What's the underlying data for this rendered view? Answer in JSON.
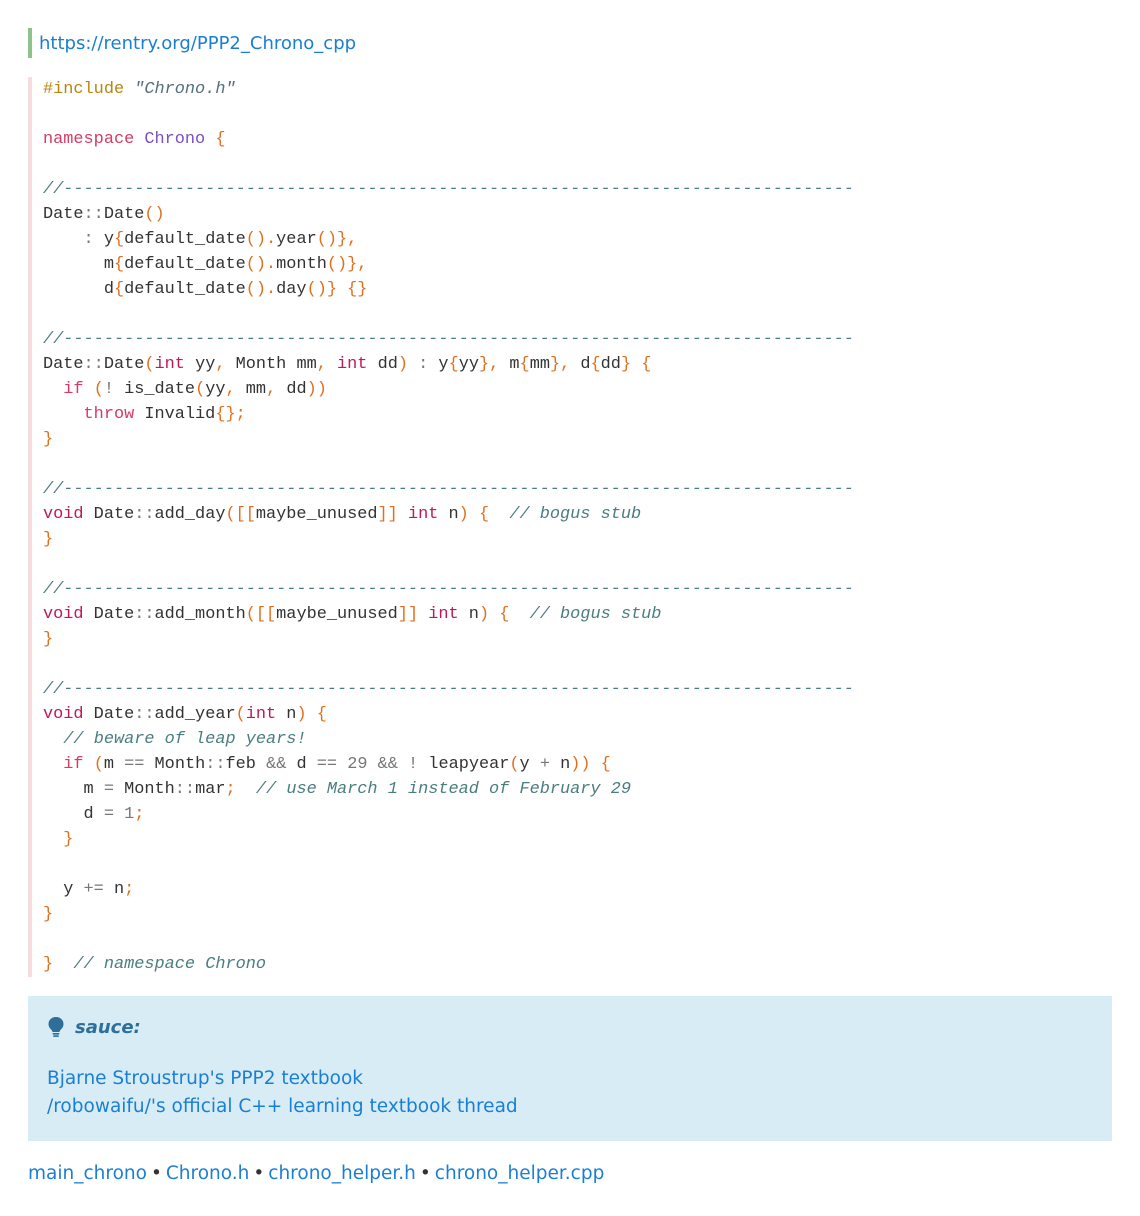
{
  "header": {
    "link": "https://rentry.org/PPP2_Chrono_cpp"
  },
  "code": {
    "lines": [
      [
        [
          "pp",
          "#include "
        ],
        [
          "str",
          "\"Chrono.h\""
        ]
      ],
      [],
      [
        [
          "kw",
          "namespace "
        ],
        [
          "ns",
          "Chrono"
        ],
        [
          "id",
          " "
        ],
        [
          "p",
          "{"
        ]
      ],
      [],
      [
        [
          "cm",
          "//------------------------------------------------------------------------------"
        ]
      ],
      [
        [
          "id",
          "Date"
        ],
        [
          "op",
          "::"
        ],
        [
          "id",
          "Date"
        ],
        [
          "p",
          "()"
        ]
      ],
      [
        [
          "id",
          "    "
        ],
        [
          "op",
          ":"
        ],
        [
          "id",
          " y"
        ],
        [
          "p",
          "{"
        ],
        [
          "id",
          "default_date"
        ],
        [
          "p",
          "()."
        ],
        [
          "id",
          "year"
        ],
        [
          "p",
          "()},"
        ]
      ],
      [
        [
          "id",
          "      m"
        ],
        [
          "p",
          "{"
        ],
        [
          "id",
          "default_date"
        ],
        [
          "p",
          "()."
        ],
        [
          "id",
          "month"
        ],
        [
          "p",
          "()},"
        ]
      ],
      [
        [
          "id",
          "      d"
        ],
        [
          "p",
          "{"
        ],
        [
          "id",
          "default_date"
        ],
        [
          "p",
          "()."
        ],
        [
          "id",
          "day"
        ],
        [
          "p",
          "()}"
        ],
        [
          "id",
          " "
        ],
        [
          "p",
          "{}"
        ]
      ],
      [],
      [
        [
          "cm",
          "//------------------------------------------------------------------------------"
        ]
      ],
      [
        [
          "id",
          "Date"
        ],
        [
          "op",
          "::"
        ],
        [
          "id",
          "Date"
        ],
        [
          "p",
          "("
        ],
        [
          "ty",
          "int"
        ],
        [
          "id",
          " yy"
        ],
        [
          "p",
          ","
        ],
        [
          "id",
          " Month mm"
        ],
        [
          "p",
          ","
        ],
        [
          "id",
          " "
        ],
        [
          "ty",
          "int"
        ],
        [
          "id",
          " dd"
        ],
        [
          "p",
          ")"
        ],
        [
          "id",
          " "
        ],
        [
          "op",
          ":"
        ],
        [
          "id",
          " y"
        ],
        [
          "p",
          "{"
        ],
        [
          "id",
          "yy"
        ],
        [
          "p",
          "},"
        ],
        [
          "id",
          " m"
        ],
        [
          "p",
          "{"
        ],
        [
          "id",
          "mm"
        ],
        [
          "p",
          "},"
        ],
        [
          "id",
          " d"
        ],
        [
          "p",
          "{"
        ],
        [
          "id",
          "dd"
        ],
        [
          "p",
          "}"
        ],
        [
          "id",
          " "
        ],
        [
          "p",
          "{"
        ]
      ],
      [
        [
          "id",
          "  "
        ],
        [
          "kw",
          "if"
        ],
        [
          "id",
          " "
        ],
        [
          "p",
          "("
        ],
        [
          "op",
          "!"
        ],
        [
          "id",
          " is_date"
        ],
        [
          "p",
          "("
        ],
        [
          "id",
          "yy"
        ],
        [
          "p",
          ","
        ],
        [
          "id",
          " mm"
        ],
        [
          "p",
          ","
        ],
        [
          "id",
          " dd"
        ],
        [
          "p",
          "))"
        ]
      ],
      [
        [
          "id",
          "    "
        ],
        [
          "kw",
          "throw"
        ],
        [
          "id",
          " Invalid"
        ],
        [
          "p",
          "{};"
        ]
      ],
      [
        [
          "p",
          "}"
        ]
      ],
      [],
      [
        [
          "cm",
          "//------------------------------------------------------------------------------"
        ]
      ],
      [
        [
          "ty",
          "void"
        ],
        [
          "id",
          " Date"
        ],
        [
          "op",
          "::"
        ],
        [
          "id",
          "add_day"
        ],
        [
          "p",
          "([["
        ],
        [
          "id",
          "maybe_unused"
        ],
        [
          "p",
          "]]"
        ],
        [
          "id",
          " "
        ],
        [
          "ty",
          "int"
        ],
        [
          "id",
          " n"
        ],
        [
          "p",
          ")"
        ],
        [
          "id",
          " "
        ],
        [
          "p",
          "{"
        ],
        [
          "id",
          "  "
        ],
        [
          "cm",
          "// bogus stub"
        ]
      ],
      [
        [
          "p",
          "}"
        ]
      ],
      [],
      [
        [
          "cm",
          "//------------------------------------------------------------------------------"
        ]
      ],
      [
        [
          "ty",
          "void"
        ],
        [
          "id",
          " Date"
        ],
        [
          "op",
          "::"
        ],
        [
          "id",
          "add_month"
        ],
        [
          "p",
          "([["
        ],
        [
          "id",
          "maybe_unused"
        ],
        [
          "p",
          "]]"
        ],
        [
          "id",
          " "
        ],
        [
          "ty",
          "int"
        ],
        [
          "id",
          " n"
        ],
        [
          "p",
          ")"
        ],
        [
          "id",
          " "
        ],
        [
          "p",
          "{"
        ],
        [
          "id",
          "  "
        ],
        [
          "cm",
          "// bogus stub"
        ]
      ],
      [
        [
          "p",
          "}"
        ]
      ],
      [],
      [
        [
          "cm",
          "//------------------------------------------------------------------------------"
        ]
      ],
      [
        [
          "ty",
          "void"
        ],
        [
          "id",
          " Date"
        ],
        [
          "op",
          "::"
        ],
        [
          "id",
          "add_year"
        ],
        [
          "p",
          "("
        ],
        [
          "ty",
          "int"
        ],
        [
          "id",
          " n"
        ],
        [
          "p",
          ")"
        ],
        [
          "id",
          " "
        ],
        [
          "p",
          "{"
        ]
      ],
      [
        [
          "id",
          "  "
        ],
        [
          "cm",
          "// beware of leap years!"
        ]
      ],
      [
        [
          "id",
          "  "
        ],
        [
          "kw",
          "if"
        ],
        [
          "id",
          " "
        ],
        [
          "p",
          "("
        ],
        [
          "id",
          "m "
        ],
        [
          "op",
          "=="
        ],
        [
          "id",
          " Month"
        ],
        [
          "op",
          "::"
        ],
        [
          "id",
          "feb "
        ],
        [
          "op",
          "&&"
        ],
        [
          "id",
          " d "
        ],
        [
          "op",
          "=="
        ],
        [
          "id",
          " "
        ],
        [
          "num",
          "29"
        ],
        [
          "id",
          " "
        ],
        [
          "op",
          "&&"
        ],
        [
          "id",
          " "
        ],
        [
          "op",
          "!"
        ],
        [
          "id",
          " leapyear"
        ],
        [
          "p",
          "("
        ],
        [
          "id",
          "y "
        ],
        [
          "op",
          "+"
        ],
        [
          "id",
          " n"
        ],
        [
          "p",
          "))"
        ],
        [
          "id",
          " "
        ],
        [
          "p",
          "{"
        ]
      ],
      [
        [
          "id",
          "    m "
        ],
        [
          "op",
          "="
        ],
        [
          "id",
          " Month"
        ],
        [
          "op",
          "::"
        ],
        [
          "id",
          "mar"
        ],
        [
          "p",
          ";"
        ],
        [
          "id",
          "  "
        ],
        [
          "cm",
          "// use March 1 instead of February 29"
        ]
      ],
      [
        [
          "id",
          "    d "
        ],
        [
          "op",
          "="
        ],
        [
          "id",
          " "
        ],
        [
          "num",
          "1"
        ],
        [
          "p",
          ";"
        ]
      ],
      [
        [
          "id",
          "  "
        ],
        [
          "p",
          "}"
        ]
      ],
      [],
      [
        [
          "id",
          "  y "
        ],
        [
          "op",
          "+="
        ],
        [
          "id",
          " n"
        ],
        [
          "p",
          ";"
        ]
      ],
      [
        [
          "p",
          "}"
        ]
      ],
      [],
      [
        [
          "p",
          "}"
        ],
        [
          "id",
          "  "
        ],
        [
          "cm",
          "// namespace Chrono"
        ]
      ]
    ]
  },
  "callout": {
    "title": "sauce:",
    "icon": "lightbulb-icon",
    "links": [
      "Bjarne Stroustrup's PPP2 textbook",
      "/robowaifu/'s official C++ learning textbook thread"
    ]
  },
  "footer": {
    "links": [
      "main_chrono",
      "Chrono.h",
      "chrono_helper.h",
      "chrono_helper.cpp"
    ],
    "separator": "•"
  },
  "colors": {
    "link": "#1a7fd4",
    "callout_bg": "#d8ecf5",
    "quote_border": "#8bc38b",
    "code_border": "#f6dcdc"
  }
}
